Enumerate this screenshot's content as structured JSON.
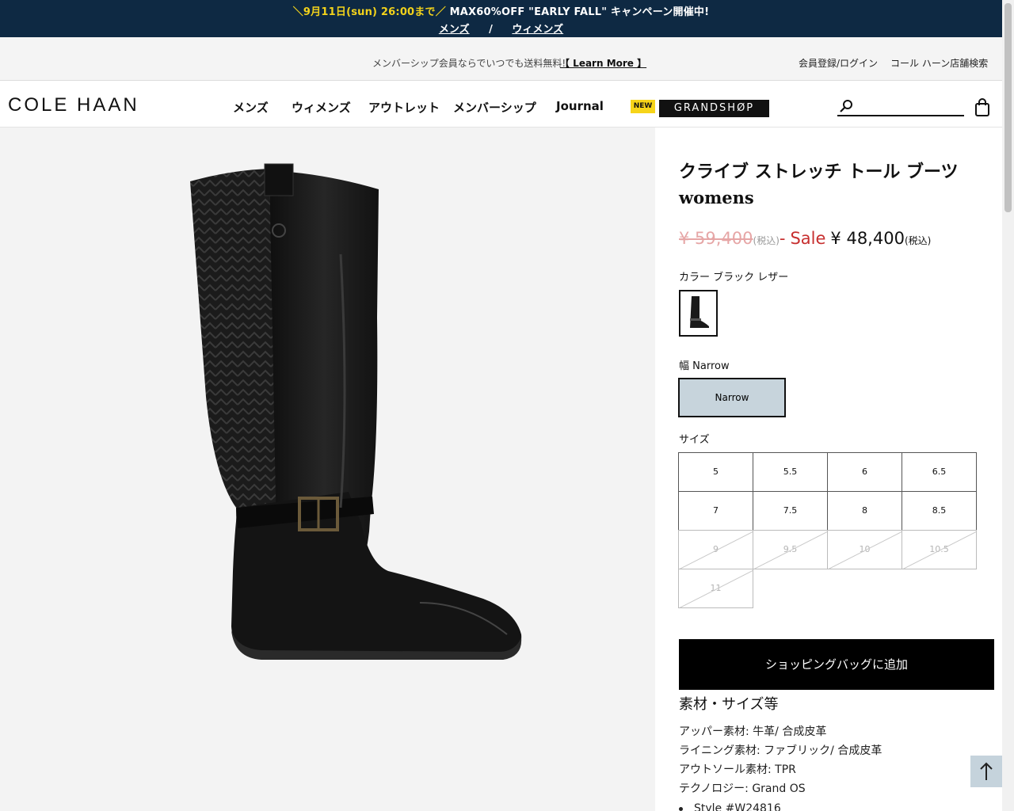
{
  "promo": {
    "highlight": "＼9月11日(sun) 26:00まで／",
    "text": " MAX60%OFF \"EARLY FALL\" キャンペーン開催中!",
    "links": [
      "メンズ",
      "ウィメンズ"
    ],
    "separator": "/"
  },
  "utility": {
    "shipping": "メンバーシップ会員ならでいつでも送料無料!",
    "learn_more": "【 Learn More 】",
    "login": "会員登録/ログイン",
    "store_search": "コール ハーン店舗検索"
  },
  "nav": {
    "logo": "COLE HAAN",
    "items": [
      "メンズ",
      "ウィメンズ",
      "アウトレット",
      "メンバーシップ",
      "Journal"
    ],
    "new_badge": "NEW",
    "grandshop": "GRANDSHØP",
    "search_placeholder": ""
  },
  "product": {
    "title": "クライブ ストレッチ トール ブーツ",
    "gender": "womens",
    "price_old": "¥ 59,400",
    "price_old_tax": "(税込)",
    "price_dash": "-",
    "sale_label": "Sale",
    "price_new": "¥ 48,400",
    "price_new_tax": "(税込)",
    "color_label": "カラー ブラック レザー",
    "width_label": "幅 Narrow",
    "width_option": "Narrow",
    "size_label": "サイズ",
    "sizes": [
      {
        "label": "5",
        "available": true
      },
      {
        "label": "5.5",
        "available": true
      },
      {
        "label": "6",
        "available": true
      },
      {
        "label": "6.5",
        "available": true
      },
      {
        "label": "7",
        "available": true
      },
      {
        "label": "7.5",
        "available": true
      },
      {
        "label": "8",
        "available": true
      },
      {
        "label": "8.5",
        "available": true
      },
      {
        "label": "9",
        "available": false
      },
      {
        "label": "9.5",
        "available": false
      },
      {
        "label": "10",
        "available": false
      },
      {
        "label": "10.5",
        "available": false
      },
      {
        "label": "11",
        "available": false
      }
    ],
    "add_to_bag": "ショッピングバッグに追加",
    "spec_heading": "素材・サイズ等",
    "specs": [
      "アッパー素材: 牛革/ 合成皮革",
      "ライニング素材: ファブリック/ 合成皮革",
      "アウトソール素材: TPR",
      "テクノロジー: Grand OS"
    ],
    "style_bullet": "Style #W24816"
  },
  "colors": {
    "promo_bg": "#0e2943",
    "promo_highlight": "#f2d21b",
    "sale": "#c72f2f",
    "width_selected": "#c7d4dc"
  }
}
